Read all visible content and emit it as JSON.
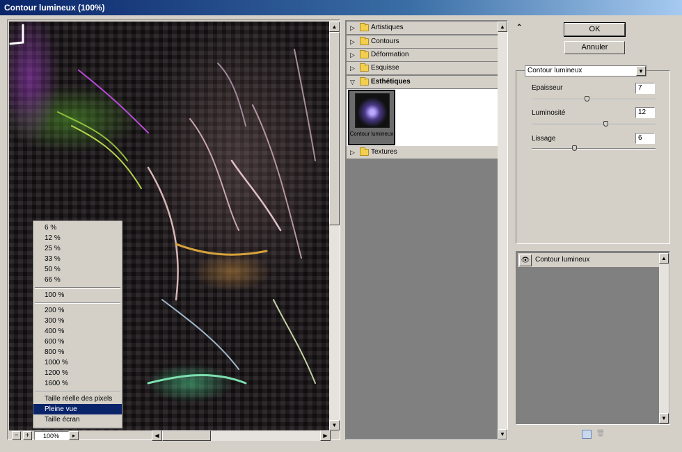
{
  "window": {
    "title": "Contour lumineux (100%)"
  },
  "preview": {
    "zoom_value": "100%",
    "zoom_menu": {
      "group1": [
        "6 %",
        "12 %",
        "25 %",
        "33 %",
        "50 %",
        "66 %"
      ],
      "group2": [
        "100 %"
      ],
      "group3": [
        "200 %",
        "300 %",
        "400 %",
        "600 %",
        "800 %",
        "1000 %",
        "1200 %",
        "1600 %"
      ],
      "group4": [
        "Taille réelle des pixels",
        "Pleine vue",
        "Taille écran"
      ],
      "selected": "Pleine vue"
    }
  },
  "gallery": {
    "categories": [
      {
        "label": "Artistiques",
        "open": false
      },
      {
        "label": "Contours",
        "open": false
      },
      {
        "label": "Déformation",
        "open": false
      },
      {
        "label": "Esquisse",
        "open": false
      },
      {
        "label": "Esthétiques",
        "open": true
      },
      {
        "label": "Textures",
        "open": false
      }
    ],
    "selected_filter": "Contour lumineux"
  },
  "buttons": {
    "ok": "OK",
    "cancel": "Annuler"
  },
  "settings": {
    "filter_select": "Contour lumineux",
    "params": [
      {
        "label": "Epaisseur",
        "value": "7",
        "level": 0.45
      },
      {
        "label": "Luminosité",
        "value": "12",
        "level": 0.6
      },
      {
        "label": "Lissage",
        "value": "6",
        "level": 0.35
      }
    ]
  },
  "layers": {
    "items": [
      {
        "name": "Contour lumineux"
      }
    ]
  },
  "colors": {
    "selection": "#0a246a",
    "face": "#d4d0c8",
    "shadow": "#808080"
  }
}
